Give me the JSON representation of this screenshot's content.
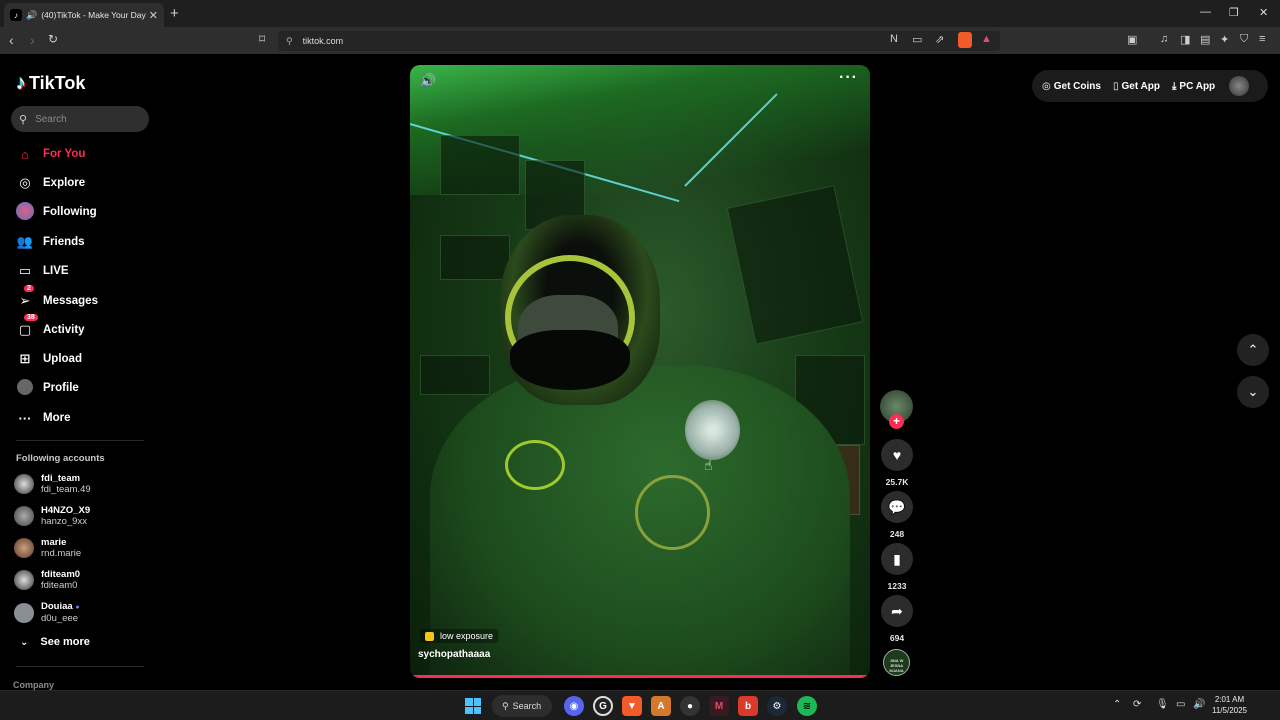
{
  "browser": {
    "tab_title": "(40)TikTok - Make Your Day",
    "url": "tiktok.com"
  },
  "sidebar": {
    "logo": "TikTok",
    "search_placeholder": "Search",
    "menu": [
      {
        "label": "For You",
        "icon": "home-icon",
        "active": true
      },
      {
        "label": "Explore",
        "icon": "compass-icon"
      },
      {
        "label": "Following",
        "icon": "following-avatar-icon"
      },
      {
        "label": "Friends",
        "icon": "friends-icon"
      },
      {
        "label": "LIVE",
        "icon": "live-icon"
      },
      {
        "label": "Messages",
        "icon": "messages-icon",
        "badge": "2"
      },
      {
        "label": "Activity",
        "icon": "activity-icon",
        "badge": "38"
      },
      {
        "label": "Upload",
        "icon": "upload-icon"
      },
      {
        "label": "Profile",
        "icon": "profile-icon"
      },
      {
        "label": "More",
        "icon": "more-icon"
      }
    ],
    "following_title": "Following accounts",
    "accounts": [
      {
        "name": "fdi_team",
        "handle": "fdi_team.49"
      },
      {
        "name": "H4NZO_X9",
        "handle": "hanzo_9xx"
      },
      {
        "name": "marie",
        "handle": "rnd.marie"
      },
      {
        "name": "fditeam0",
        "handle": "fditeam0"
      },
      {
        "name": "Douiaa",
        "handle": "d0u_eee"
      }
    ],
    "see_more": "See more",
    "company": "Company"
  },
  "video": {
    "effect_label": "low exposure",
    "author": "sychopathaaaa",
    "likes": "25.7K",
    "comments": "248",
    "saves": "1233",
    "shares": "694",
    "music_disc_text": "JINA W JESNA MJANA"
  },
  "header": {
    "get_coins": "Get Coins",
    "get_app": "Get App",
    "pc_app": "PC App"
  },
  "taskbar": {
    "search": "Search",
    "time": "2:01 AM",
    "date": "11/5/2025"
  },
  "colors": {
    "accent": "#fe2c55",
    "background": "#000000",
    "taskbar": "#1c1c1c"
  }
}
